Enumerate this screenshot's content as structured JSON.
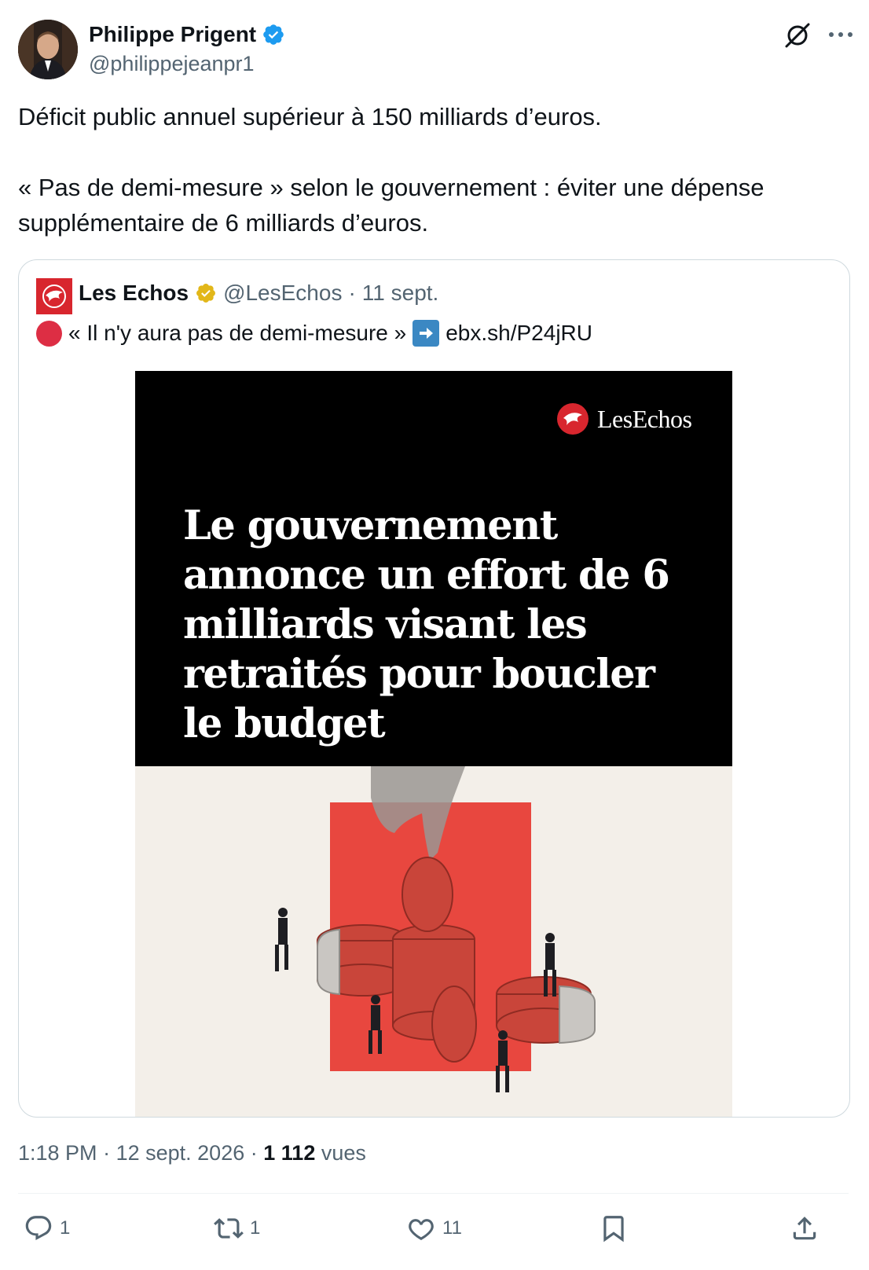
{
  "author": {
    "display_name": "Philippe Prigent",
    "handle": "@philippejeanpr1",
    "verified": true,
    "verified_color": "#1d9bf0"
  },
  "tweet": {
    "paragraphs": [
      "Déficit public annuel supérieur à 150 milliards d’euros.",
      "« Pas de demi-mesure » selon le gouvernement : éviter une dépense supplémentaire de 6 milliards d’euros."
    ]
  },
  "quote": {
    "display_name": "Les Echos",
    "handle": "@LesEchos",
    "separator": "·",
    "date": "11 sept.",
    "verified_badge": "gold",
    "text_quote": "« Il n'y aura pas de demi-mesure »",
    "link": "ebx.sh/P24jRU",
    "media": {
      "brand": "LesEchos",
      "headline": "Le gouvernement annonce un effort de 6 milliards visant les retraités pour boucler le budget"
    }
  },
  "meta": {
    "time": "1:18 PM",
    "separator": "·",
    "date": "12 sept. 2026",
    "views_count": "1 112",
    "views_label": "vues"
  },
  "actions": {
    "replies": "1",
    "retweets": "1",
    "likes": "11"
  },
  "colors": {
    "accent": "#1d9bf0",
    "muted_text": "#536471",
    "brand_red": "#d8262e",
    "border": "#cfd9de"
  },
  "icons": {
    "grok": "grok-icon",
    "more": "more-horizontal-icon",
    "reply": "reply-icon",
    "retweet": "retweet-icon",
    "like": "heart-icon",
    "bookmark": "bookmark-icon",
    "share": "share-icon"
  }
}
